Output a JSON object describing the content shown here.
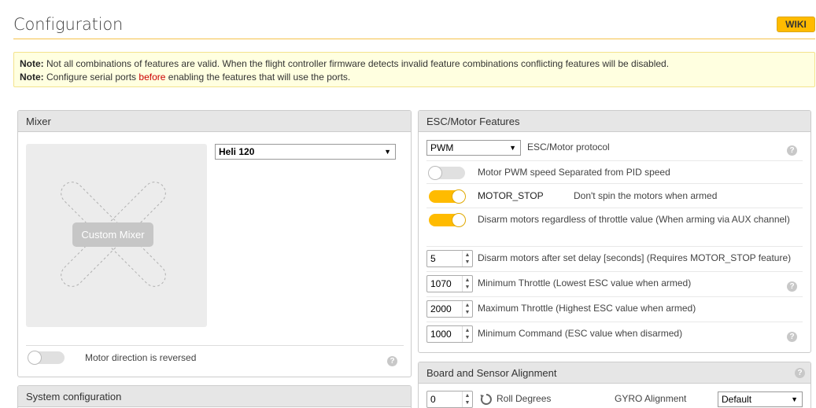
{
  "header": {
    "title": "Configuration",
    "wiki_label": "WIKI"
  },
  "notes": {
    "line1_prefix": "Note:",
    "line1_text": " Not all combinations of features are valid. When the flight controller firmware detects invalid feature combinations conflicting features will be disabled.",
    "line2_prefix": "Note:",
    "line2_text_a": " Configure serial ports ",
    "line2_text_red": "before",
    "line2_text_b": " enabling the features that will use the ports."
  },
  "mixer": {
    "title": "Mixer",
    "selected": "Heli 120",
    "preview_label": "Custom Mixer",
    "reverse_label": "Motor direction is reversed",
    "reverse_on": false
  },
  "system": {
    "title": "System configuration"
  },
  "esc": {
    "title": "ESC/Motor Features",
    "protocol_value": "PWM",
    "protocol_label": "ESC/Motor protocol",
    "pwm_speed_label": "Motor PWM speed Separated from PID speed",
    "pwm_speed_on": false,
    "motor_stop_name": "MOTOR_STOP",
    "motor_stop_desc": "Don't spin the motors when armed",
    "motor_stop_on": true,
    "disarm_label": "Disarm motors regardless of throttle value (When arming via AUX channel)",
    "disarm_on": true,
    "disarm_delay_value": "5",
    "disarm_delay_label": "Disarm motors after set delay [seconds] (Requires MOTOR_STOP feature)",
    "min_throttle_value": "1070",
    "min_throttle_label": "Minimum Throttle (Lowest ESC value when armed)",
    "max_throttle_value": "2000",
    "max_throttle_label": "Maximum Throttle (Highest ESC value when armed)",
    "min_command_value": "1000",
    "min_command_label": "Minimum Command (ESC value when disarmed)"
  },
  "board": {
    "title": "Board and Sensor Alignment",
    "roll_value": "0",
    "roll_label": "Roll Degrees",
    "gyro_label": "GYRO Alignment",
    "gyro_value": "Default"
  },
  "help_glyph": "?",
  "colors": {
    "accent": "#ffbb00",
    "note_bg": "#ffffe0",
    "warning_red": "#cc0000"
  }
}
